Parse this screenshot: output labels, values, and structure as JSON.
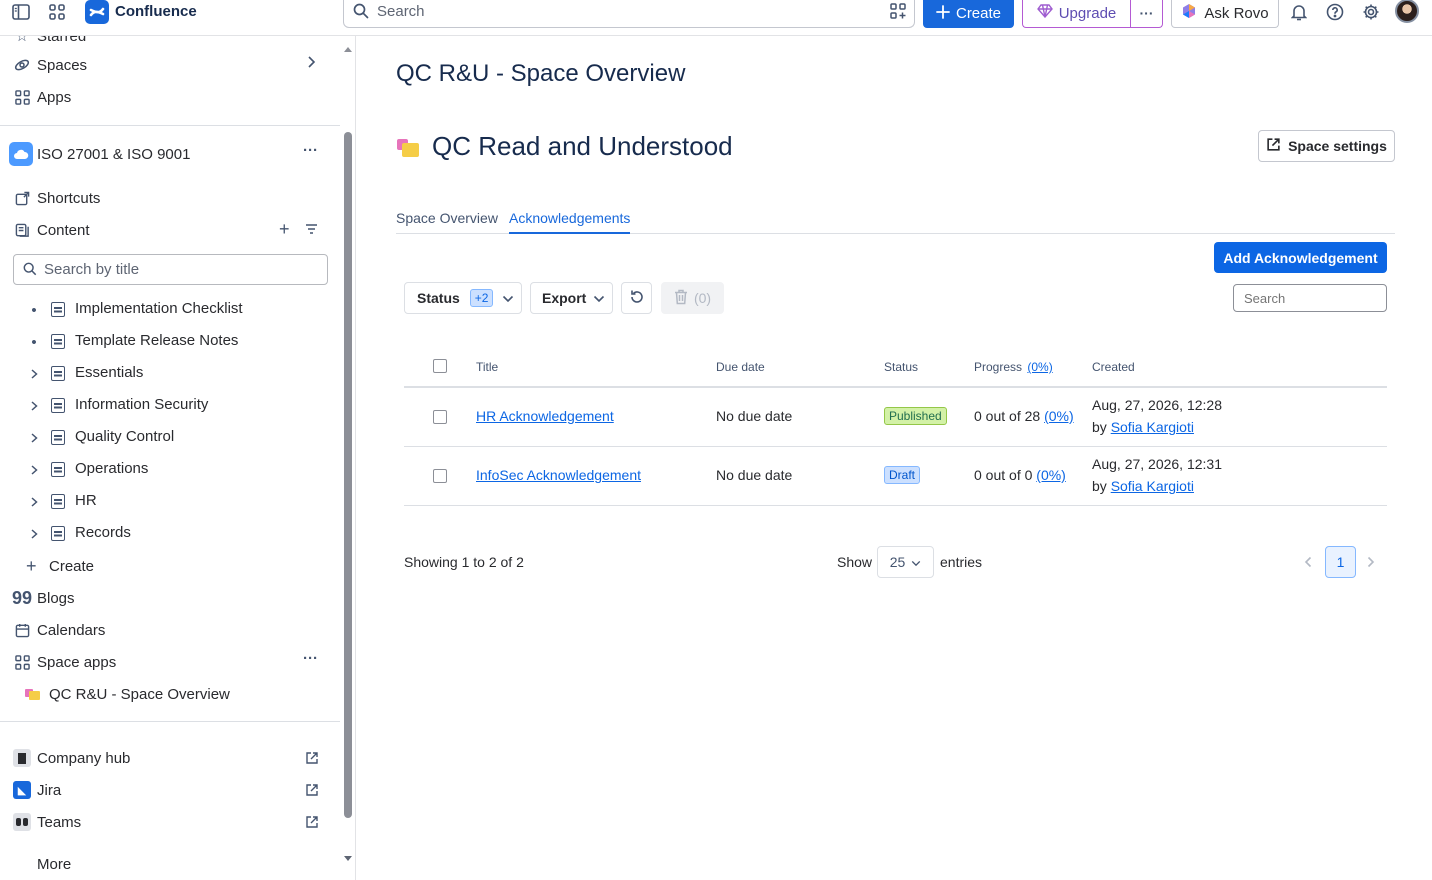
{
  "topbar": {
    "app_name": "Confluence",
    "search_placeholder": "Search",
    "create_label": "Create",
    "upgrade_label": "Upgrade",
    "more_label": "···",
    "rovo_label": "Ask Rovo"
  },
  "sidebar": {
    "partial_top_label": "Starred",
    "spaces_label": "Spaces",
    "apps_label": "Apps",
    "space_name": "ISO 27001 & ISO 9001",
    "space_more": "···",
    "shortcuts_label": "Shortcuts",
    "content_label": "Content",
    "search_placeholder": "Search by title",
    "tree": [
      {
        "label": "Implementation Checklist",
        "kind": "bullet"
      },
      {
        "label": "Template Release Notes",
        "kind": "bullet"
      },
      {
        "label": "Essentials",
        "kind": "chevron"
      },
      {
        "label": "Information Security",
        "kind": "chevron"
      },
      {
        "label": "Quality Control",
        "kind": "chevron"
      },
      {
        "label": "Operations",
        "kind": "chevron"
      },
      {
        "label": "HR",
        "kind": "chevron"
      },
      {
        "label": "Records",
        "kind": "chevron"
      }
    ],
    "create_label": "Create",
    "blogs_label": "Blogs",
    "calendars_label": "Calendars",
    "space_apps_label": "Space apps",
    "space_apps_more": "···",
    "space_app_item": "QC R&U - Space Overview",
    "company_hub_label": "Company hub",
    "jira_label": "Jira",
    "teams_label": "Teams",
    "partial_bottom_label": "More"
  },
  "main": {
    "page_title": "QC R&U - Space Overview",
    "space_title": "QC Read and Understood",
    "space_settings_label": "Space settings",
    "tabs": [
      {
        "label": "Space Overview",
        "active": false
      },
      {
        "label": "Acknowledgements",
        "active": true
      }
    ],
    "add_button_label": "Add Acknowledgement",
    "filters": {
      "status_label": "Status",
      "status_count": "+2",
      "export_label": "Export",
      "delete_count": "(0)"
    },
    "table_search_placeholder": "Search",
    "table": {
      "headers": {
        "title": "Title",
        "due_date": "Due date",
        "status": "Status",
        "progress": "Progress",
        "progress_link": "(0%)",
        "created": "Created"
      },
      "rows": [
        {
          "title": "HR Acknowledgement",
          "due_date": "No due date",
          "status": "Published",
          "progress_text": "0 out of 28",
          "progress_link": "(0%)",
          "created_date": "Aug, 27, 2026, 12:28",
          "created_by_prefix": "by",
          "created_by": "Sofia Kargioti"
        },
        {
          "title": "InfoSec Acknowledgement",
          "due_date": "No due date",
          "status": "Draft",
          "progress_text": "0 out of 0",
          "progress_link": "(0%)",
          "created_date": "Aug, 27, 2026, 12:31",
          "created_by_prefix": "by",
          "created_by": "Sofia Kargioti"
        }
      ]
    },
    "footer": {
      "showing": "Showing 1 to 2 of 2",
      "show_label": "Show",
      "entries_value": "25",
      "entries_label": "entries",
      "current_page": "1"
    }
  },
  "colors": {
    "brand_blue": "#1868db",
    "link_blue": "#0c66e4",
    "upgrade_purple": "#b45ad3",
    "published_green": "#d3f1a7",
    "draft_blue": "#cce0ff"
  }
}
